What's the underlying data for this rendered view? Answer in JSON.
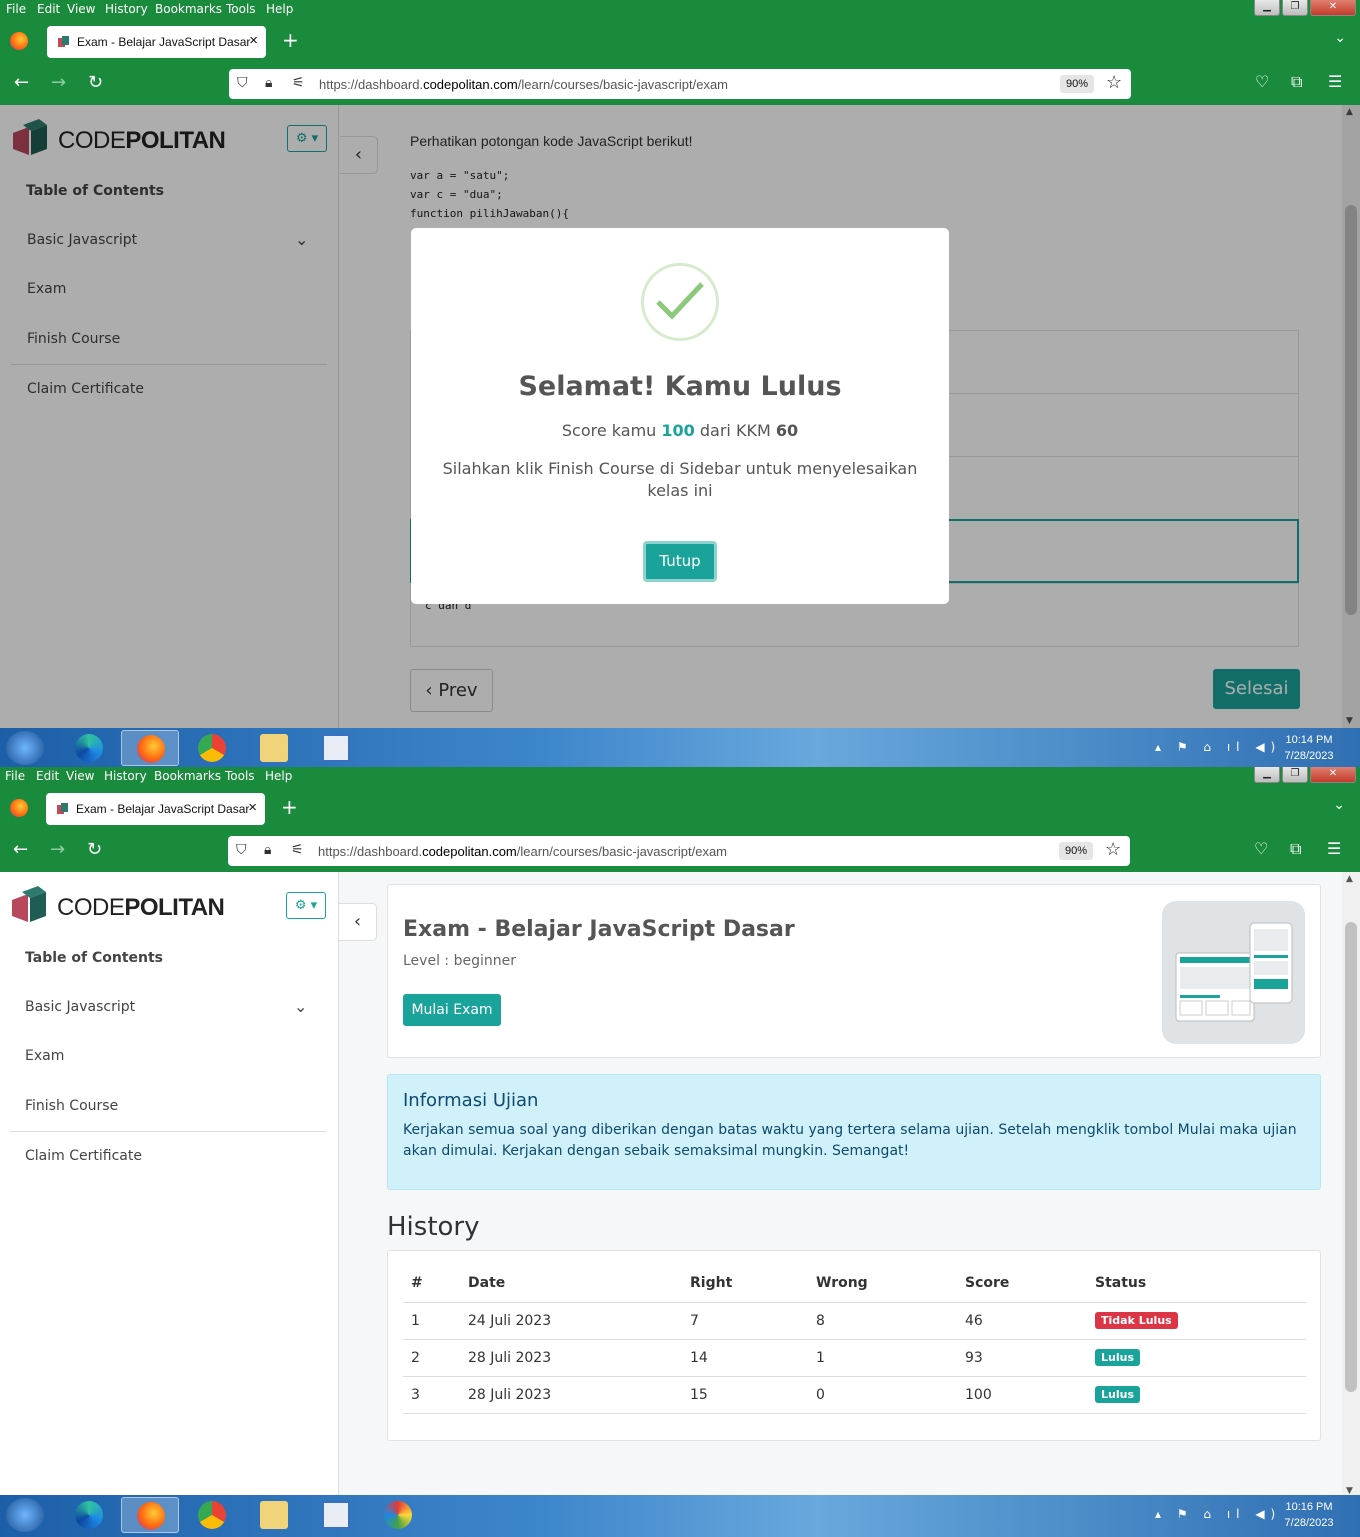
{
  "browser": {
    "menu": [
      "File",
      "Edit",
      "View",
      "History",
      "Bookmarks",
      "Tools",
      "Help"
    ],
    "tab_title": "Exam - Belajar JavaScript Dasar",
    "url_prefix": "https://dashboard.",
    "url_domain": "codepolitan.com",
    "url_path": "/learn/courses/basic-javascript/exam",
    "zoom": "90%"
  },
  "sidebar": {
    "logo_bold": "CODE",
    "logo_rest": "POLITAN",
    "toc_title": "Table of Contents",
    "items": [
      "Basic Javascript",
      "Exam",
      "Finish Course",
      "Claim Certificate"
    ]
  },
  "exam_question": {
    "prompt": "Perhatikan potongan kode JavaScript berikut!",
    "code": [
      "var a = \"satu\";",
      "var c = \"dua\";",
      "function pilihJawaban(){"
    ],
    "visible_option": "c dan d",
    "prev_label": "Prev",
    "finish_label": "Selesai"
  },
  "modal": {
    "title": "Selamat! Kamu Lulus",
    "score_prefix": "Score kamu",
    "score": "100",
    "score_mid": "dari KKM",
    "kkm": "60",
    "message": "Silahkan klik Finish Course di Sidebar untuk menyelesaikan kelas ini",
    "close_label": "Tutup"
  },
  "taskbar1": {
    "time": "10:14 PM",
    "date": "7/28/2023"
  },
  "taskbar2": {
    "time": "10:16 PM",
    "date": "7/28/2023"
  },
  "exam_page": {
    "title": "Exam - Belajar JavaScript Dasar",
    "level": "Level : beginner",
    "start_label": "Mulai Exam",
    "info_title": "Informasi Ujian",
    "info_body": "Kerjakan semua soal yang diberikan dengan batas waktu yang tertera selama ujian. Setelah mengklik tombol Mulai maka ujian akan dimulai. Kerjakan dengan sebaik semaksimal mungkin. Semangat!",
    "history_title": "History",
    "columns": [
      "#",
      "Date",
      "Right",
      "Wrong",
      "Score",
      "Status"
    ],
    "rows": [
      {
        "no": "1",
        "date": "24 Juli 2023",
        "right": "7",
        "wrong": "8",
        "score": "46",
        "status": "Tidak Lulus"
      },
      {
        "no": "2",
        "date": "28 Juli 2023",
        "right": "14",
        "wrong": "1",
        "score": "93",
        "status": "Lulus"
      },
      {
        "no": "3",
        "date": "28 Juli 2023",
        "right": "15",
        "wrong": "0",
        "score": "100",
        "status": "Lulus"
      }
    ]
  },
  "colors": {
    "accent": "#1aa39a",
    "browser_green": "#1a8b3c",
    "fail": "#dc3545",
    "info_bg": "#d1f1fa"
  }
}
